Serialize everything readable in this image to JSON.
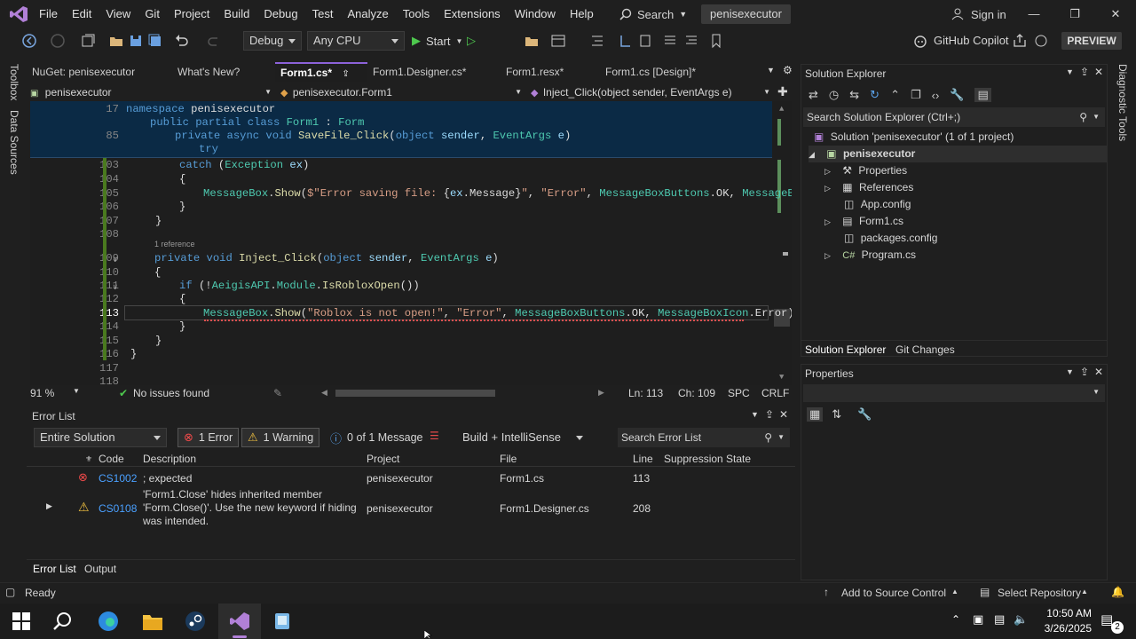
{
  "menubar": {
    "items": [
      "File",
      "Edit",
      "View",
      "Git",
      "Project",
      "Build",
      "Debug",
      "Test",
      "Analyze",
      "Tools",
      "Extensions",
      "Window",
      "Help"
    ],
    "search": "Search",
    "solution": "penisexecutor",
    "signin": "Sign in"
  },
  "toolbar": {
    "config": "Debug",
    "platform": "Any CPU",
    "start": "Start",
    "copilot": "GitHub Copilot",
    "preview": "PREVIEW"
  },
  "rails": {
    "toolbox": "Toolbox",
    "datasources": "Data Sources",
    "diagnostic": "Diagnostic Tools"
  },
  "tabs": [
    "NuGet: penisexecutor",
    "What's New?",
    "Form1.cs*",
    "Form1.Designer.cs*",
    "Form1.resx*",
    "Form1.cs [Design]*"
  ],
  "nav": {
    "project": "penisexecutor",
    "class": "penisexecutor.Form1",
    "member": "Inject_Click(object sender, EventArgs e)"
  },
  "editor": {
    "reference": "1 reference",
    "lines": [
      "17",
      "85",
      "103",
      "104",
      "105",
      "106",
      "107",
      "108",
      "109",
      "110",
      "111",
      "112",
      "113",
      "114",
      "115",
      "116",
      "117",
      "118"
    ]
  },
  "edstatus": {
    "zoom": "91 %",
    "issues": "No issues found",
    "ln": "Ln: 113",
    "ch": "Ch: 109",
    "spc": "SPC",
    "crlf": "CRLF"
  },
  "errorlist": {
    "title": "Error List",
    "scope": "Entire Solution",
    "errors": "1 Error",
    "warnings": "1 Warning",
    "messages": "0 of 1 Message",
    "build": "Build + IntelliSense",
    "search": "Search Error List",
    "cols": [
      "Code",
      "Description",
      "Project",
      "File",
      "Line",
      "Suppression State"
    ],
    "rows": [
      {
        "code": "CS1002",
        "desc": "; expected",
        "project": "penisexecutor",
        "file": "Form1.cs",
        "line": "113"
      },
      {
        "code": "CS0108",
        "desc1": "'Form1.Close' hides inherited member",
        "desc2": "'Form.Close()'. Use the new keyword if hiding",
        "desc3": "was intended.",
        "project": "penisexecutor",
        "file": "Form1.Designer.cs",
        "line": "208"
      }
    ],
    "tabs": [
      "Error List",
      "Output"
    ]
  },
  "solution": {
    "title": "Solution Explorer",
    "search": "Search Solution Explorer (Ctrl+;)",
    "root": "Solution 'penisexecutor' (1 of 1 project)",
    "project": "penisexecutor",
    "items": [
      "Properties",
      "References",
      "App.config",
      "Form1.cs",
      "packages.config",
      "Program.cs"
    ],
    "tabs": [
      "Solution Explorer",
      "Git Changes"
    ]
  },
  "properties": {
    "title": "Properties"
  },
  "statusbar": {
    "ready": "Ready",
    "source": "Add to Source Control",
    "repo": "Select Repository"
  },
  "taskbar": {
    "time": "10:50 AM",
    "date": "3/26/2025",
    "notif": "2"
  }
}
